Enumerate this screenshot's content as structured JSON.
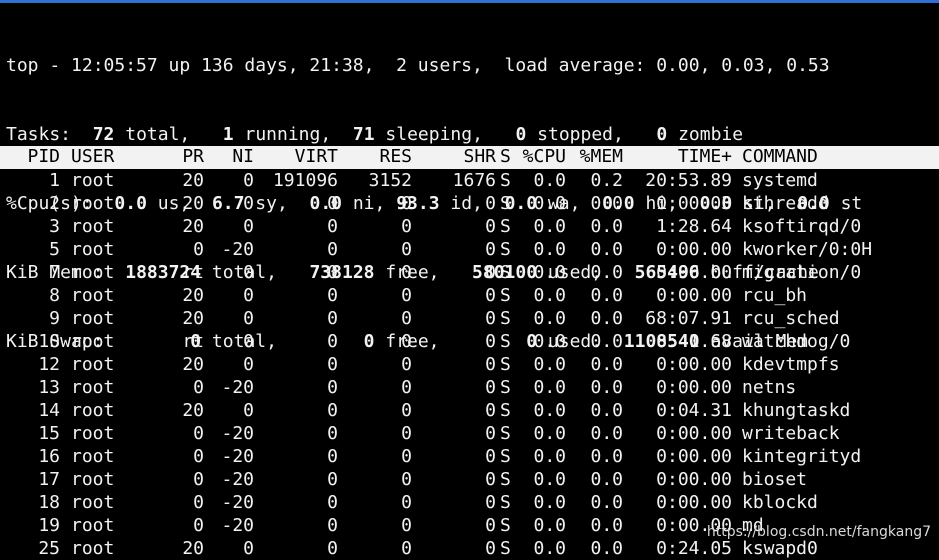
{
  "summary": {
    "uptime": "top - 12:05:57 up 136 days, 21:38,  2 users,  load average: 0.00, 0.03, 0.53",
    "tasks": {
      "label": "Tasks:",
      "total": "72",
      "total_label": "total,",
      "running": "1",
      "running_label": "running,",
      "sleeping": "71",
      "sleeping_label": "sleeping,",
      "stopped": "0",
      "stopped_label": "stopped,",
      "zombie": "0",
      "zombie_label": "zombie"
    },
    "cpu": {
      "label": "%Cpu(s):",
      "us": "0.0",
      "sy": "6.7",
      "ni": "0.0",
      "id": "93.3",
      "wa": "0.0",
      "hi": "0.0",
      "si": "0.0",
      "st": "0.0"
    },
    "mem": {
      "label": "KiB Mem :",
      "total": "1883724",
      "free": "738128",
      "used": "580100",
      "buff_cache": "565496"
    },
    "swap": {
      "label": "KiB Swap:",
      "total": "0",
      "free": "0",
      "used": "0",
      "avail_mem": "1108540"
    }
  },
  "columns": {
    "pid": "PID",
    "user": "USER",
    "pr": "PR",
    "ni": "NI",
    "virt": "VIRT",
    "res": "RES",
    "shr": "SHR",
    "s": "S",
    "cpu": "%CPU",
    "mem": "%MEM",
    "time": "TIME+",
    "command": "COMMAND"
  },
  "processes": [
    {
      "pid": "1",
      "user": "root",
      "pr": "20",
      "ni": "0",
      "virt": "191096",
      "res": "3152",
      "shr": "1676",
      "s": "S",
      "cpu": "0.0",
      "mem": "0.2",
      "time": "20:53.89",
      "command": "systemd"
    },
    {
      "pid": "2",
      "user": "root",
      "pr": "20",
      "ni": "0",
      "virt": "0",
      "res": "0",
      "shr": "0",
      "s": "S",
      "cpu": "0.0",
      "mem": "0.0",
      "time": "0:00.03",
      "command": "kthreadd"
    },
    {
      "pid": "3",
      "user": "root",
      "pr": "20",
      "ni": "0",
      "virt": "0",
      "res": "0",
      "shr": "0",
      "s": "S",
      "cpu": "0.0",
      "mem": "0.0",
      "time": "1:28.64",
      "command": "ksoftirqd/0"
    },
    {
      "pid": "5",
      "user": "root",
      "pr": "0",
      "ni": "-20",
      "virt": "0",
      "res": "0",
      "shr": "0",
      "s": "S",
      "cpu": "0.0",
      "mem": "0.0",
      "time": "0:00.00",
      "command": "kworker/0:0H"
    },
    {
      "pid": "7",
      "user": "root",
      "pr": "rt",
      "ni": "0",
      "virt": "0",
      "res": "0",
      "shr": "0",
      "s": "S",
      "cpu": "0.0",
      "mem": "0.0",
      "time": "0:00.00",
      "command": "migration/0"
    },
    {
      "pid": "8",
      "user": "root",
      "pr": "20",
      "ni": "0",
      "virt": "0",
      "res": "0",
      "shr": "0",
      "s": "S",
      "cpu": "0.0",
      "mem": "0.0",
      "time": "0:00.00",
      "command": "rcu_bh"
    },
    {
      "pid": "9",
      "user": "root",
      "pr": "20",
      "ni": "0",
      "virt": "0",
      "res": "0",
      "shr": "0",
      "s": "S",
      "cpu": "0.0",
      "mem": "0.0",
      "time": "68:07.91",
      "command": "rcu_sched"
    },
    {
      "pid": "10",
      "user": "root",
      "pr": "rt",
      "ni": "0",
      "virt": "0",
      "res": "0",
      "shr": "0",
      "s": "S",
      "cpu": "0.0",
      "mem": "0.0",
      "time": "0:41.68",
      "command": "watchdog/0"
    },
    {
      "pid": "12",
      "user": "root",
      "pr": "20",
      "ni": "0",
      "virt": "0",
      "res": "0",
      "shr": "0",
      "s": "S",
      "cpu": "0.0",
      "mem": "0.0",
      "time": "0:00.00",
      "command": "kdevtmpfs"
    },
    {
      "pid": "13",
      "user": "root",
      "pr": "0",
      "ni": "-20",
      "virt": "0",
      "res": "0",
      "shr": "0",
      "s": "S",
      "cpu": "0.0",
      "mem": "0.0",
      "time": "0:00.00",
      "command": "netns"
    },
    {
      "pid": "14",
      "user": "root",
      "pr": "20",
      "ni": "0",
      "virt": "0",
      "res": "0",
      "shr": "0",
      "s": "S",
      "cpu": "0.0",
      "mem": "0.0",
      "time": "0:04.31",
      "command": "khungtaskd"
    },
    {
      "pid": "15",
      "user": "root",
      "pr": "0",
      "ni": "-20",
      "virt": "0",
      "res": "0",
      "shr": "0",
      "s": "S",
      "cpu": "0.0",
      "mem": "0.0",
      "time": "0:00.00",
      "command": "writeback"
    },
    {
      "pid": "16",
      "user": "root",
      "pr": "0",
      "ni": "-20",
      "virt": "0",
      "res": "0",
      "shr": "0",
      "s": "S",
      "cpu": "0.0",
      "mem": "0.0",
      "time": "0:00.00",
      "command": "kintegrityd"
    },
    {
      "pid": "17",
      "user": "root",
      "pr": "0",
      "ni": "-20",
      "virt": "0",
      "res": "0",
      "shr": "0",
      "s": "S",
      "cpu": "0.0",
      "mem": "0.0",
      "time": "0:00.00",
      "command": "bioset"
    },
    {
      "pid": "18",
      "user": "root",
      "pr": "0",
      "ni": "-20",
      "virt": "0",
      "res": "0",
      "shr": "0",
      "s": "S",
      "cpu": "0.0",
      "mem": "0.0",
      "time": "0:00.00",
      "command": "kblockd"
    },
    {
      "pid": "19",
      "user": "root",
      "pr": "0",
      "ni": "-20",
      "virt": "0",
      "res": "0",
      "shr": "0",
      "s": "S",
      "cpu": "0.0",
      "mem": "0.0",
      "time": "0:00.00",
      "command": "md"
    },
    {
      "pid": "25",
      "user": "root",
      "pr": "20",
      "ni": "0",
      "virt": "0",
      "res": "0",
      "shr": "0",
      "s": "S",
      "cpu": "0.0",
      "mem": "0.0",
      "time": "0:24.05",
      "command": "kswapd0"
    }
  ],
  "watermark": "https://blog.csdn.net/fangkang7"
}
